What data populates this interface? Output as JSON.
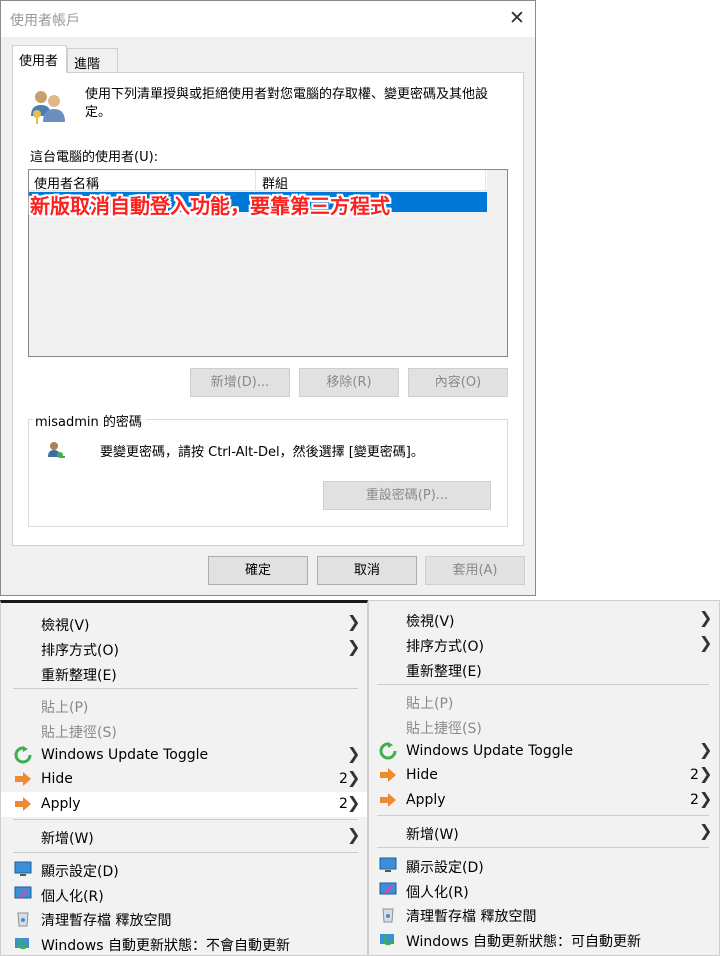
{
  "dialog": {
    "title": "使用者帳戶",
    "tabs": [
      "使用者",
      "進階"
    ],
    "intro": "使用下列清單授與或拒絕使用者對您電腦的存取權、變更密碼及其他設定。",
    "users_label": "這台電腦的使用者(U):",
    "columns": [
      "使用者名稱",
      "群組"
    ],
    "overlay_note": "新版取消自動登入功能，要靠第三方程式",
    "buttons": {
      "add": "新增(D)...",
      "remove": "移除(R)",
      "properties": "內容(O)"
    },
    "password_group": "misadmin 的密碼",
    "password_text": "要變更密碼，請按 Ctrl-Alt-Del，然後選擇 [變更密碼]。",
    "reset_button": "重設密碼(P)...",
    "ok": "確定",
    "cancel": "取消",
    "apply": "套用(A)"
  },
  "menu_left": {
    "view": "檢視(V)",
    "sort": "排序方式(O)",
    "refresh": "重新整理(E)",
    "paste": "貼上(P)",
    "paste_shortcut": "貼上捷徑(S)",
    "wu_toggle": "Windows Update Toggle",
    "hide": "Hide",
    "hide_num": "2",
    "apply": "Apply",
    "apply_num": "2",
    "new": "新增(W)",
    "display": "顯示設定(D)",
    "personalize": "個人化(R)",
    "cleanup": "清理暫存檔 釋放空間",
    "wu_status": "Windows 自動更新狀態：不會自動更新"
  },
  "menu_right": {
    "view": "檢視(V)",
    "sort": "排序方式(O)",
    "refresh": "重新整理(E)",
    "paste": "貼上(P)",
    "paste_shortcut": "貼上捷徑(S)",
    "wu_toggle": "Windows Update Toggle",
    "hide": "Hide",
    "hide_num": "2",
    "apply": "Apply",
    "apply_num": "2",
    "new": "新增(W)",
    "display": "顯示設定(D)",
    "personalize": "個人化(R)",
    "cleanup": "清理暫存檔 釋放空間",
    "wu_status": "Windows 自動更新狀態：可自動更新"
  }
}
